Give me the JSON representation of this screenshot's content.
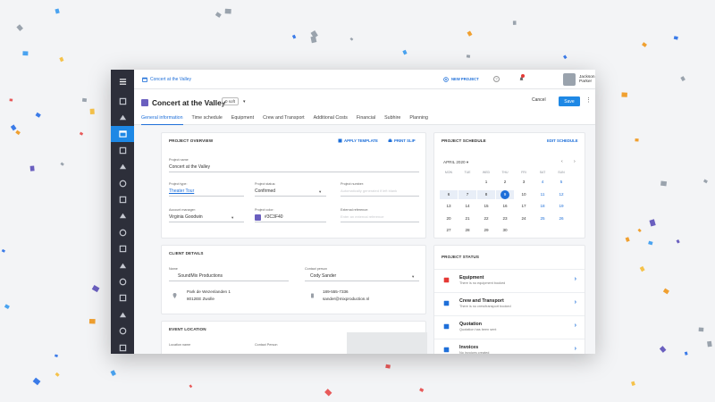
{
  "topbar": {
    "breadcrumb": "Concert at the Valley",
    "new_project": "NEW PROJECT",
    "help": "?",
    "user_name": "Jackson Parker"
  },
  "header": {
    "title": "Concert at the Valley",
    "count": "0 soft",
    "cancel": "Cancel",
    "save": "Save",
    "tabs": [
      "General information",
      "Time schedule",
      "Equipment",
      "Crew and Transport",
      "Additional Costs",
      "Financial",
      "Subhire",
      "Planning"
    ]
  },
  "overview": {
    "heading": "PROJECT OVERVIEW",
    "apply_template": "APPLY TEMPLATE",
    "print_slip": "PRINT SLIP",
    "project_name_label": "Project name",
    "project_name": "Concert at the Valley",
    "project_type_label": "Project type:",
    "project_type": "Theater Tour",
    "project_status_label": "Project status:",
    "project_status": "Confirmed",
    "project_number_label": "Project number:",
    "project_number_placeholder": "Automatically generated if left blank",
    "account_manager_label": "Account manager:",
    "account_manager": "Virginia Goodwin",
    "project_color_label": "Project color:",
    "project_color": "#3C3F40",
    "external_reference_label": "External reference:",
    "external_reference_placeholder": "Enter an external reference"
  },
  "client": {
    "heading": "CLIENT DETAILS",
    "name_label": "Name",
    "name": "SoundMix Productions",
    "contact_label": "Contact person",
    "contact": "Cody Sander",
    "address_line1": "Park de Wezenlanden 1",
    "address_line2": "8012EE Zwolle",
    "phone": "189-555-7336",
    "email": "sander@mixproduction.nl"
  },
  "event": {
    "heading": "EVENT LOCATION",
    "location_label": "Location name",
    "contact_label": "Contact Person"
  },
  "schedule": {
    "heading": "PROJECT SCHEDULE",
    "edit": "EDIT SCHEDULE",
    "month": "APRIL 2020",
    "day_names": [
      "MON",
      "TUE",
      "WED",
      "THU",
      "FRI",
      "SAT",
      "SUN"
    ],
    "weeks": [
      [
        "",
        "",
        "1",
        "2",
        "3",
        "4",
        "5"
      ],
      [
        "6",
        "7",
        "8",
        "9",
        "10",
        "11",
        "12"
      ],
      [
        "13",
        "14",
        "15",
        "16",
        "17",
        "18",
        "19"
      ],
      [
        "20",
        "21",
        "22",
        "23",
        "24",
        "25",
        "26"
      ],
      [
        "27",
        "28",
        "29",
        "30",
        "",
        "",
        ""
      ]
    ],
    "today": "9"
  },
  "status": {
    "heading": "PROJECT STATUS",
    "items": [
      {
        "title": "Equipment",
        "subtitle": "There is no equipment booked"
      },
      {
        "title": "Crew and Transport",
        "subtitle": "There is no crew/transport booked"
      },
      {
        "title": "Quotation",
        "subtitle": "Quotation has been sent"
      },
      {
        "title": "Invoices",
        "subtitle": "No invoices created"
      }
    ]
  },
  "colors": {
    "accent": "#1e88e5",
    "rail": "#2d2f3a",
    "project": "#6a5fbf"
  }
}
